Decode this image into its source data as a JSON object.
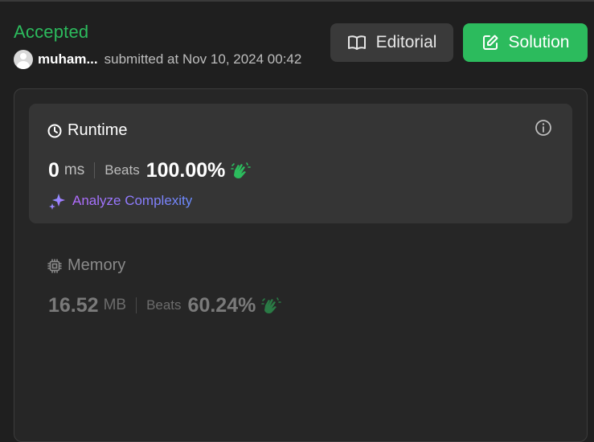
{
  "result": {
    "status": "Accepted",
    "user": "muham...",
    "submitted_text": "submitted at Nov 10, 2024 00:42"
  },
  "buttons": {
    "editorial": "Editorial",
    "solution": "Solution"
  },
  "runtime": {
    "title": "Runtime",
    "value": "0",
    "unit": "ms",
    "beats_label": "Beats",
    "beats_pct": "100.00%",
    "analyze_label": "Analyze Complexity"
  },
  "memory": {
    "title": "Memory",
    "value": "16.52",
    "unit": "MB",
    "beats_label": "Beats",
    "beats_pct": "60.24%"
  },
  "colors": {
    "accent_green": "#2cbb5d",
    "background": "#1f1f1f",
    "card": "#353535"
  },
  "icons": [
    "user-avatar-icon",
    "book-icon",
    "edit-icon",
    "clock-icon",
    "info-icon",
    "clap-icon",
    "sparkle-icon",
    "chip-icon"
  ]
}
